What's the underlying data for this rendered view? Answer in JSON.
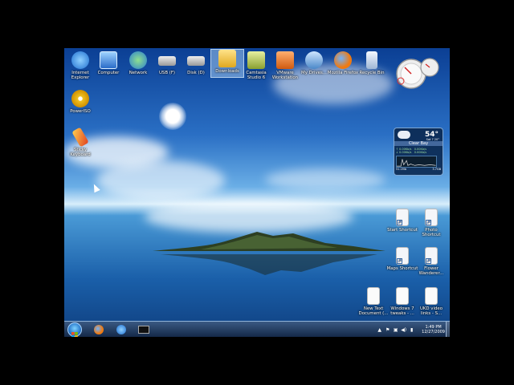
{
  "desktop_icons": [
    {
      "label": "Internet Explorer",
      "icon": "internet-explorer-icon"
    },
    {
      "label": "Computer",
      "icon": "computer-icon"
    },
    {
      "label": "Network",
      "icon": "network-icon"
    },
    {
      "label": "USB (F)",
      "icon": "usb-drive-icon"
    },
    {
      "label": "Disk (D)",
      "icon": "disk-drive-icon"
    },
    {
      "label": "Downloads",
      "icon": "downloads-folder-icon"
    },
    {
      "label": "Camtasia Studio 6",
      "icon": "camtasia-icon"
    },
    {
      "label": "VMware Workstation",
      "icon": "vmware-icon"
    },
    {
      "label": "My Drives...",
      "icon": "drives-icon"
    },
    {
      "label": "Mozilla Firefox",
      "icon": "firefox-icon"
    },
    {
      "label": "Recycle Bin",
      "icon": "recycle-bin-icon"
    },
    {
      "label": "PowerISO",
      "icon": "poweriso-icon"
    },
    {
      "label": "Sticky Keyboard",
      "icon": "sticky-keyboard-icon"
    },
    {
      "label": "Start Shortcut",
      "icon": "shortcut-icon"
    },
    {
      "label": "Photo Shortcut",
      "icon": "shortcut-icon"
    },
    {
      "label": "Maps Shortcut",
      "icon": "shortcut-icon"
    },
    {
      "label": "Flower Wanderer...",
      "icon": "shortcut-icon"
    },
    {
      "label": "New Text Document (...",
      "icon": "text-document-icon"
    },
    {
      "label": "Windows 7 tweaks - ...",
      "icon": "text-document-icon"
    },
    {
      "label": "UKD video links - S...",
      "icon": "text-document-icon"
    }
  ],
  "weather_widget": {
    "temperature": "54°",
    "city": "Clear Bay",
    "date": "Sat 7 20°",
    "upload": "0.00Kb/s",
    "download": "0.00Kb/s",
    "sent": "51.1Mb",
    "received": "3.7GB"
  },
  "taskbar": {
    "time": "1:49 PM",
    "date": "12/27/2009",
    "pinned": [
      "firefox-icon",
      "internet-explorer-icon",
      "cmd-icon"
    ]
  }
}
